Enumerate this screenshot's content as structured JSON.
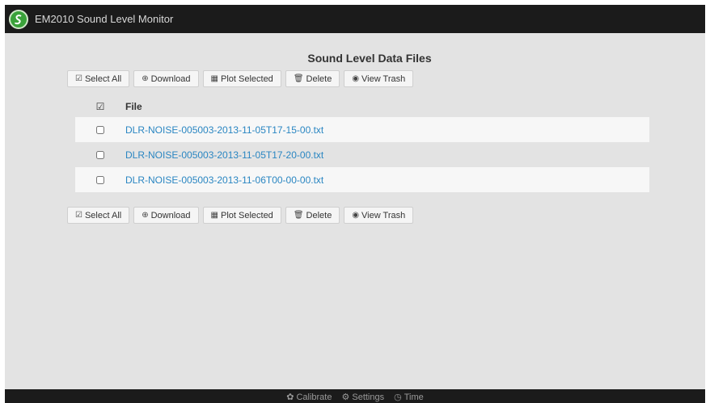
{
  "app": {
    "title": "EM2010 Sound Level Monitor",
    "logo_icon": "s-swirl-logo",
    "colors": {
      "navbar": "#1b1b1b",
      "link": "#2a86c2",
      "logo": "#3aa23a",
      "background": "#e3e3e3"
    }
  },
  "page": {
    "title": "Sound Level Data Files"
  },
  "toolbar": {
    "select_all": "Select All",
    "download": "Download",
    "plot_selected": "Plot Selected",
    "delete": "Delete",
    "view_trash": "View Trash",
    "icons": [
      "check-square-icon",
      "circle-arrow-down-icon",
      "bar-chart-icon",
      "trash-icon",
      "eye-icon"
    ]
  },
  "table": {
    "header_file": "File",
    "rows": [
      {
        "name": "DLR-NOISE-005003-2013-11-05T17-15-00.txt",
        "checked": false
      },
      {
        "name": "DLR-NOISE-005003-2013-11-05T17-20-00.txt",
        "checked": false
      },
      {
        "name": "DLR-NOISE-005003-2013-11-06T00-00-00.txt",
        "checked": false
      }
    ]
  },
  "footer": {
    "calibrate": "Calibrate",
    "settings": "Settings",
    "time": "Time",
    "icons": [
      "gear-small-icon",
      "gear-icon",
      "clock-icon"
    ]
  }
}
